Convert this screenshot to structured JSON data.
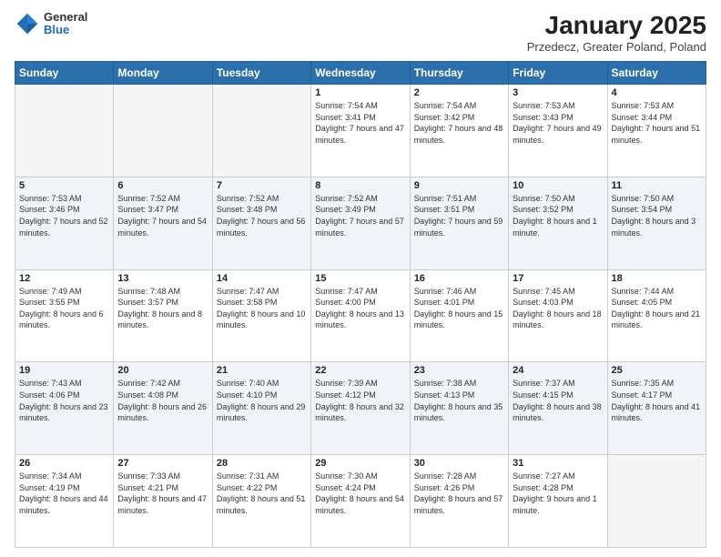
{
  "header": {
    "logo_line1": "General",
    "logo_line2": "Blue",
    "title": "January 2025",
    "subtitle": "Przedecz, Greater Poland, Poland"
  },
  "days": [
    "Sunday",
    "Monday",
    "Tuesday",
    "Wednesday",
    "Thursday",
    "Friday",
    "Saturday"
  ],
  "weeks": [
    [
      {
        "date": "",
        "info": ""
      },
      {
        "date": "",
        "info": ""
      },
      {
        "date": "",
        "info": ""
      },
      {
        "date": "1",
        "info": "Sunrise: 7:54 AM\nSunset: 3:41 PM\nDaylight: 7 hours and 47 minutes."
      },
      {
        "date": "2",
        "info": "Sunrise: 7:54 AM\nSunset: 3:42 PM\nDaylight: 7 hours and 48 minutes."
      },
      {
        "date": "3",
        "info": "Sunrise: 7:53 AM\nSunset: 3:43 PM\nDaylight: 7 hours and 49 minutes."
      },
      {
        "date": "4",
        "info": "Sunrise: 7:53 AM\nSunset: 3:44 PM\nDaylight: 7 hours and 51 minutes."
      }
    ],
    [
      {
        "date": "5",
        "info": "Sunrise: 7:53 AM\nSunset: 3:46 PM\nDaylight: 7 hours and 52 minutes."
      },
      {
        "date": "6",
        "info": "Sunrise: 7:52 AM\nSunset: 3:47 PM\nDaylight: 7 hours and 54 minutes."
      },
      {
        "date": "7",
        "info": "Sunrise: 7:52 AM\nSunset: 3:48 PM\nDaylight: 7 hours and 56 minutes."
      },
      {
        "date": "8",
        "info": "Sunrise: 7:52 AM\nSunset: 3:49 PM\nDaylight: 7 hours and 57 minutes."
      },
      {
        "date": "9",
        "info": "Sunrise: 7:51 AM\nSunset: 3:51 PM\nDaylight: 7 hours and 59 minutes."
      },
      {
        "date": "10",
        "info": "Sunrise: 7:50 AM\nSunset: 3:52 PM\nDaylight: 8 hours and 1 minute."
      },
      {
        "date": "11",
        "info": "Sunrise: 7:50 AM\nSunset: 3:54 PM\nDaylight: 8 hours and 3 minutes."
      }
    ],
    [
      {
        "date": "12",
        "info": "Sunrise: 7:49 AM\nSunset: 3:55 PM\nDaylight: 8 hours and 6 minutes."
      },
      {
        "date": "13",
        "info": "Sunrise: 7:48 AM\nSunset: 3:57 PM\nDaylight: 8 hours and 8 minutes."
      },
      {
        "date": "14",
        "info": "Sunrise: 7:47 AM\nSunset: 3:58 PM\nDaylight: 8 hours and 10 minutes."
      },
      {
        "date": "15",
        "info": "Sunrise: 7:47 AM\nSunset: 4:00 PM\nDaylight: 8 hours and 13 minutes."
      },
      {
        "date": "16",
        "info": "Sunrise: 7:46 AM\nSunset: 4:01 PM\nDaylight: 8 hours and 15 minutes."
      },
      {
        "date": "17",
        "info": "Sunrise: 7:45 AM\nSunset: 4:03 PM\nDaylight: 8 hours and 18 minutes."
      },
      {
        "date": "18",
        "info": "Sunrise: 7:44 AM\nSunset: 4:05 PM\nDaylight: 8 hours and 21 minutes."
      }
    ],
    [
      {
        "date": "19",
        "info": "Sunrise: 7:43 AM\nSunset: 4:06 PM\nDaylight: 8 hours and 23 minutes."
      },
      {
        "date": "20",
        "info": "Sunrise: 7:42 AM\nSunset: 4:08 PM\nDaylight: 8 hours and 26 minutes."
      },
      {
        "date": "21",
        "info": "Sunrise: 7:40 AM\nSunset: 4:10 PM\nDaylight: 8 hours and 29 minutes."
      },
      {
        "date": "22",
        "info": "Sunrise: 7:39 AM\nSunset: 4:12 PM\nDaylight: 8 hours and 32 minutes."
      },
      {
        "date": "23",
        "info": "Sunrise: 7:38 AM\nSunset: 4:13 PM\nDaylight: 8 hours and 35 minutes."
      },
      {
        "date": "24",
        "info": "Sunrise: 7:37 AM\nSunset: 4:15 PM\nDaylight: 8 hours and 38 minutes."
      },
      {
        "date": "25",
        "info": "Sunrise: 7:35 AM\nSunset: 4:17 PM\nDaylight: 8 hours and 41 minutes."
      }
    ],
    [
      {
        "date": "26",
        "info": "Sunrise: 7:34 AM\nSunset: 4:19 PM\nDaylight: 8 hours and 44 minutes."
      },
      {
        "date": "27",
        "info": "Sunrise: 7:33 AM\nSunset: 4:21 PM\nDaylight: 8 hours and 47 minutes."
      },
      {
        "date": "28",
        "info": "Sunrise: 7:31 AM\nSunset: 4:22 PM\nDaylight: 8 hours and 51 minutes."
      },
      {
        "date": "29",
        "info": "Sunrise: 7:30 AM\nSunset: 4:24 PM\nDaylight: 8 hours and 54 minutes."
      },
      {
        "date": "30",
        "info": "Sunrise: 7:28 AM\nSunset: 4:26 PM\nDaylight: 8 hours and 57 minutes."
      },
      {
        "date": "31",
        "info": "Sunrise: 7:27 AM\nSunset: 4:28 PM\nDaylight: 9 hours and 1 minute."
      },
      {
        "date": "",
        "info": ""
      }
    ]
  ]
}
